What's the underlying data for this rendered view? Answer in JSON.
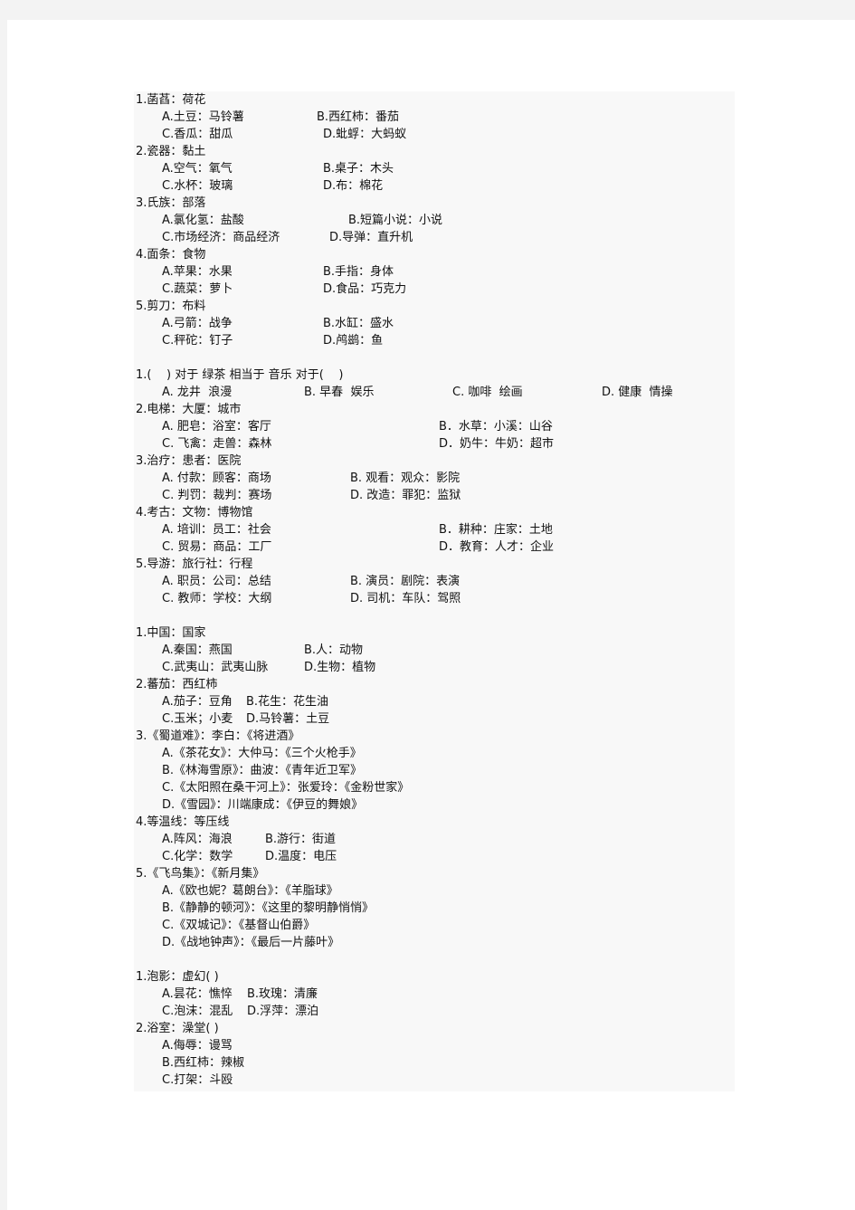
{
  "document": {
    "sections": [
      {
        "questions": [
          {
            "stem": "1.菡萏：荷花",
            "option_rows": [
              [
                "A.土豆：马铃薯",
                "B.西红柿：番茄"
              ],
              [
                "C.香瓜：甜瓜",
                "D.蚍蜉：大蚂蚁"
              ]
            ]
          },
          {
            "stem": "2.瓷器：黏土",
            "option_rows": [
              [
                "A.空气：氧气",
                "B.桌子：木头"
              ],
              [
                "C.水杯：玻璃",
                "D.布：棉花"
              ]
            ]
          },
          {
            "stem": "3.氏族：部落",
            "option_rows": [
              [
                "A.氯化氢：盐酸",
                "B.短篇小说：小说"
              ],
              [
                "C.市场经济：商品经济",
                "D.导弹：直升机"
              ]
            ]
          },
          {
            "stem": "4.面条：食物",
            "option_rows": [
              [
                "A.苹果：水果",
                "B.手指：身体"
              ],
              [
                "C.蔬菜：萝卜",
                "D.食品：巧克力"
              ]
            ]
          },
          {
            "stem": "5.剪刀：布料",
            "option_rows": [
              [
                "A.弓箭：战争",
                "B.水缸：盛水"
              ],
              [
                "C.秤砣：钉子",
                "D.鸬鹚：鱼"
              ]
            ]
          }
        ]
      },
      {
        "questions": [
          {
            "stem": "1.(    ) 对于 绿茶 相当于 音乐 对于(    )",
            "option_rows": [
              [
                "A. 龙井  浪漫",
                "B. 早春  娱乐",
                "C. 咖啡  绘画",
                "D. 健康  情操"
              ]
            ]
          },
          {
            "stem": "2.电梯：大厦：城市",
            "option_rows": [
              [
                "A. 肥皂：浴室：客厅",
                "B．水草：小溪：山谷"
              ],
              [
                "C. 飞禽：走兽：森林",
                "D．奶牛：牛奶：超市"
              ]
            ]
          },
          {
            "stem": "3.治疗：患者：医院",
            "option_rows": [
              [
                "A. 付款：顾客：商场",
                "B. 观看：观众：影院"
              ],
              [
                "C. 判罚：裁判：赛场",
                "D. 改造：罪犯：监狱"
              ]
            ]
          },
          {
            "stem": "4.考古：文物：博物馆",
            "option_rows": [
              [
                "A. 培训：员工：社会",
                "B．耕种：庄家：土地"
              ],
              [
                "C. 贸易：商品：工厂",
                "D．教育：人才：企业"
              ]
            ]
          },
          {
            "stem": "5.导游：旅行社：行程",
            "option_rows": [
              [
                "A. 职员：公司：总结",
                "B. 演员：剧院：表演"
              ],
              [
                "C. 教师：学校：大纲",
                "D. 司机：车队：驾照"
              ]
            ]
          }
        ]
      },
      {
        "questions": [
          {
            "stem": "1.中国：国家",
            "option_rows": [
              [
                "A.秦国：燕国",
                "B.人：动物"
              ],
              [
                "C.武夷山：武夷山脉",
                "D.生物：植物"
              ]
            ]
          },
          {
            "stem": "2.蕃茄：西红柿",
            "option_rows": [
              [
                "A.茄子：豆角",
                "B.花生：花生油"
              ],
              [
                "C.玉米；小麦",
                "D.马铃薯：土豆"
              ]
            ]
          },
          {
            "stem": "3.《蜀道难》：李白：《将进酒》",
            "option_rows": [
              [
                "A.《茶花女》：大仲马：《三个火枪手》"
              ],
              [
                "B.《林海雪原》：曲波：《青年近卫军》"
              ],
              [
                "C.《太阳照在桑干河上》：张爱玲：《金粉世家》"
              ],
              [
                "D.《雪园》：川端康成：《伊豆的舞娘》"
              ]
            ]
          },
          {
            "stem": "4.等温线：等压线",
            "option_rows": [
              [
                "A.阵风：海浪",
                "B.游行：街道"
              ],
              [
                "C.化学：数学",
                "D.温度：电压"
              ]
            ]
          },
          {
            "stem": "5.《飞鸟集》：《新月集》",
            "option_rows": [
              [
                "A.《欧也妮？葛朗台》：《羊脂球》"
              ],
              [
                "B.《静静的顿河》：《这里的黎明静悄悄》"
              ],
              [
                "C.《双城记》：《基督山伯爵》"
              ],
              [
                "D.《战地钟声》：《最后一片藤叶》"
              ]
            ]
          }
        ]
      },
      {
        "questions": [
          {
            "stem": "1.泡影：虚幻( )",
            "option_rows": [
              [
                "A.昙花：憔悴",
                "B.玫瑰：清廉"
              ],
              [
                "C.泡沫：混乱",
                "D.浮萍：漂泊"
              ]
            ]
          },
          {
            "stem": "2.浴室：澡堂( )",
            "option_rows": [
              [
                "A.侮辱：谩骂"
              ],
              [
                "B.西红柿：辣椒"
              ],
              [
                "C.打架：斗殴"
              ]
            ]
          }
        ]
      }
    ]
  }
}
